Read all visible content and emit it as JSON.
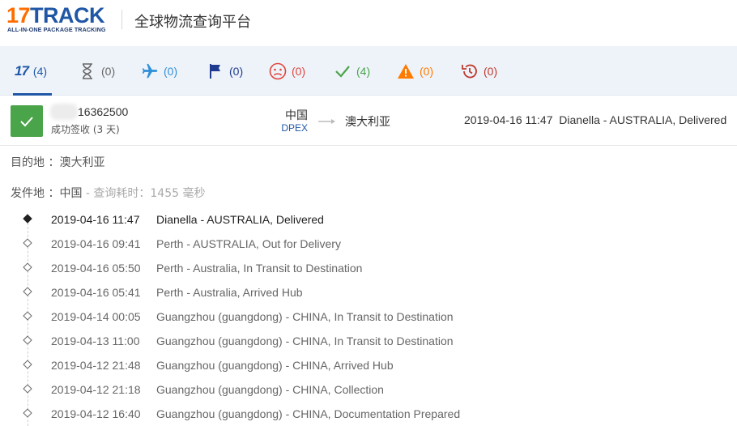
{
  "header": {
    "logo_num": "17",
    "logo_word": "TRACK",
    "logo_tagline": "ALL-IN-ONE PACKAGE TRACKING",
    "title": "全球物流查询平台"
  },
  "tabs": [
    {
      "icon": "17track-icon",
      "count": "(4)",
      "color": "#1f57a6"
    },
    {
      "icon": "hourglass-icon",
      "count": "(0)",
      "color": "#666666"
    },
    {
      "icon": "airplane-icon",
      "count": "(0)",
      "color": "#2f8fd8"
    },
    {
      "icon": "flag-icon",
      "count": "(0)",
      "color": "#1f3b8f"
    },
    {
      "icon": "sad-face-icon",
      "count": "(0)",
      "color": "#e0443b"
    },
    {
      "icon": "checkmark-icon",
      "count": "(4)",
      "color": "#4aa449"
    },
    {
      "icon": "warning-icon",
      "count": "(0)",
      "color": "#ff7a00"
    },
    {
      "icon": "history-icon",
      "count": "(0)",
      "color": "#c0392b"
    }
  ],
  "tab_17_label": "17",
  "summary": {
    "tracking_number": "16362500",
    "status": "成功签收 (3 天)",
    "origin": "中国",
    "carrier": "DPEX",
    "destination": "澳大利亚",
    "latest_time": "2019-04-16 11:47",
    "latest_event": "Dianella - AUSTRALIA, Delivered"
  },
  "info": {
    "dest_label": "目的地 ：",
    "dest_value": "澳大利亚",
    "origin_label": "发件地 ：",
    "origin_value": "中国",
    "query_time": " - 查询耗时：1455 毫秒"
  },
  "events": [
    {
      "time": "2019-04-16 11:47",
      "desc": "Dianella - AUSTRALIA, Delivered"
    },
    {
      "time": "2019-04-16 09:41",
      "desc": "Perth - AUSTRALIA, Out for Delivery"
    },
    {
      "time": "2019-04-16 05:50",
      "desc": "Perth - Australia, In Transit to Destination"
    },
    {
      "time": "2019-04-16 05:41",
      "desc": "Perth - Australia, Arrived Hub"
    },
    {
      "time": "2019-04-14 00:05",
      "desc": "Guangzhou (guangdong) - CHINA, In Transit to Destination"
    },
    {
      "time": "2019-04-13 11:00",
      "desc": "Guangzhou (guangdong) - CHINA, In Transit to Destination"
    },
    {
      "time": "2019-04-12 21:48",
      "desc": "Guangzhou (guangdong) - CHINA, Arrived Hub"
    },
    {
      "time": "2019-04-12 21:18",
      "desc": "Guangzhou (guangdong) - CHINA, Collection"
    },
    {
      "time": "2019-04-12 16:40",
      "desc": "Guangzhou (guangdong) - CHINA, Documentation Prepared"
    }
  ]
}
